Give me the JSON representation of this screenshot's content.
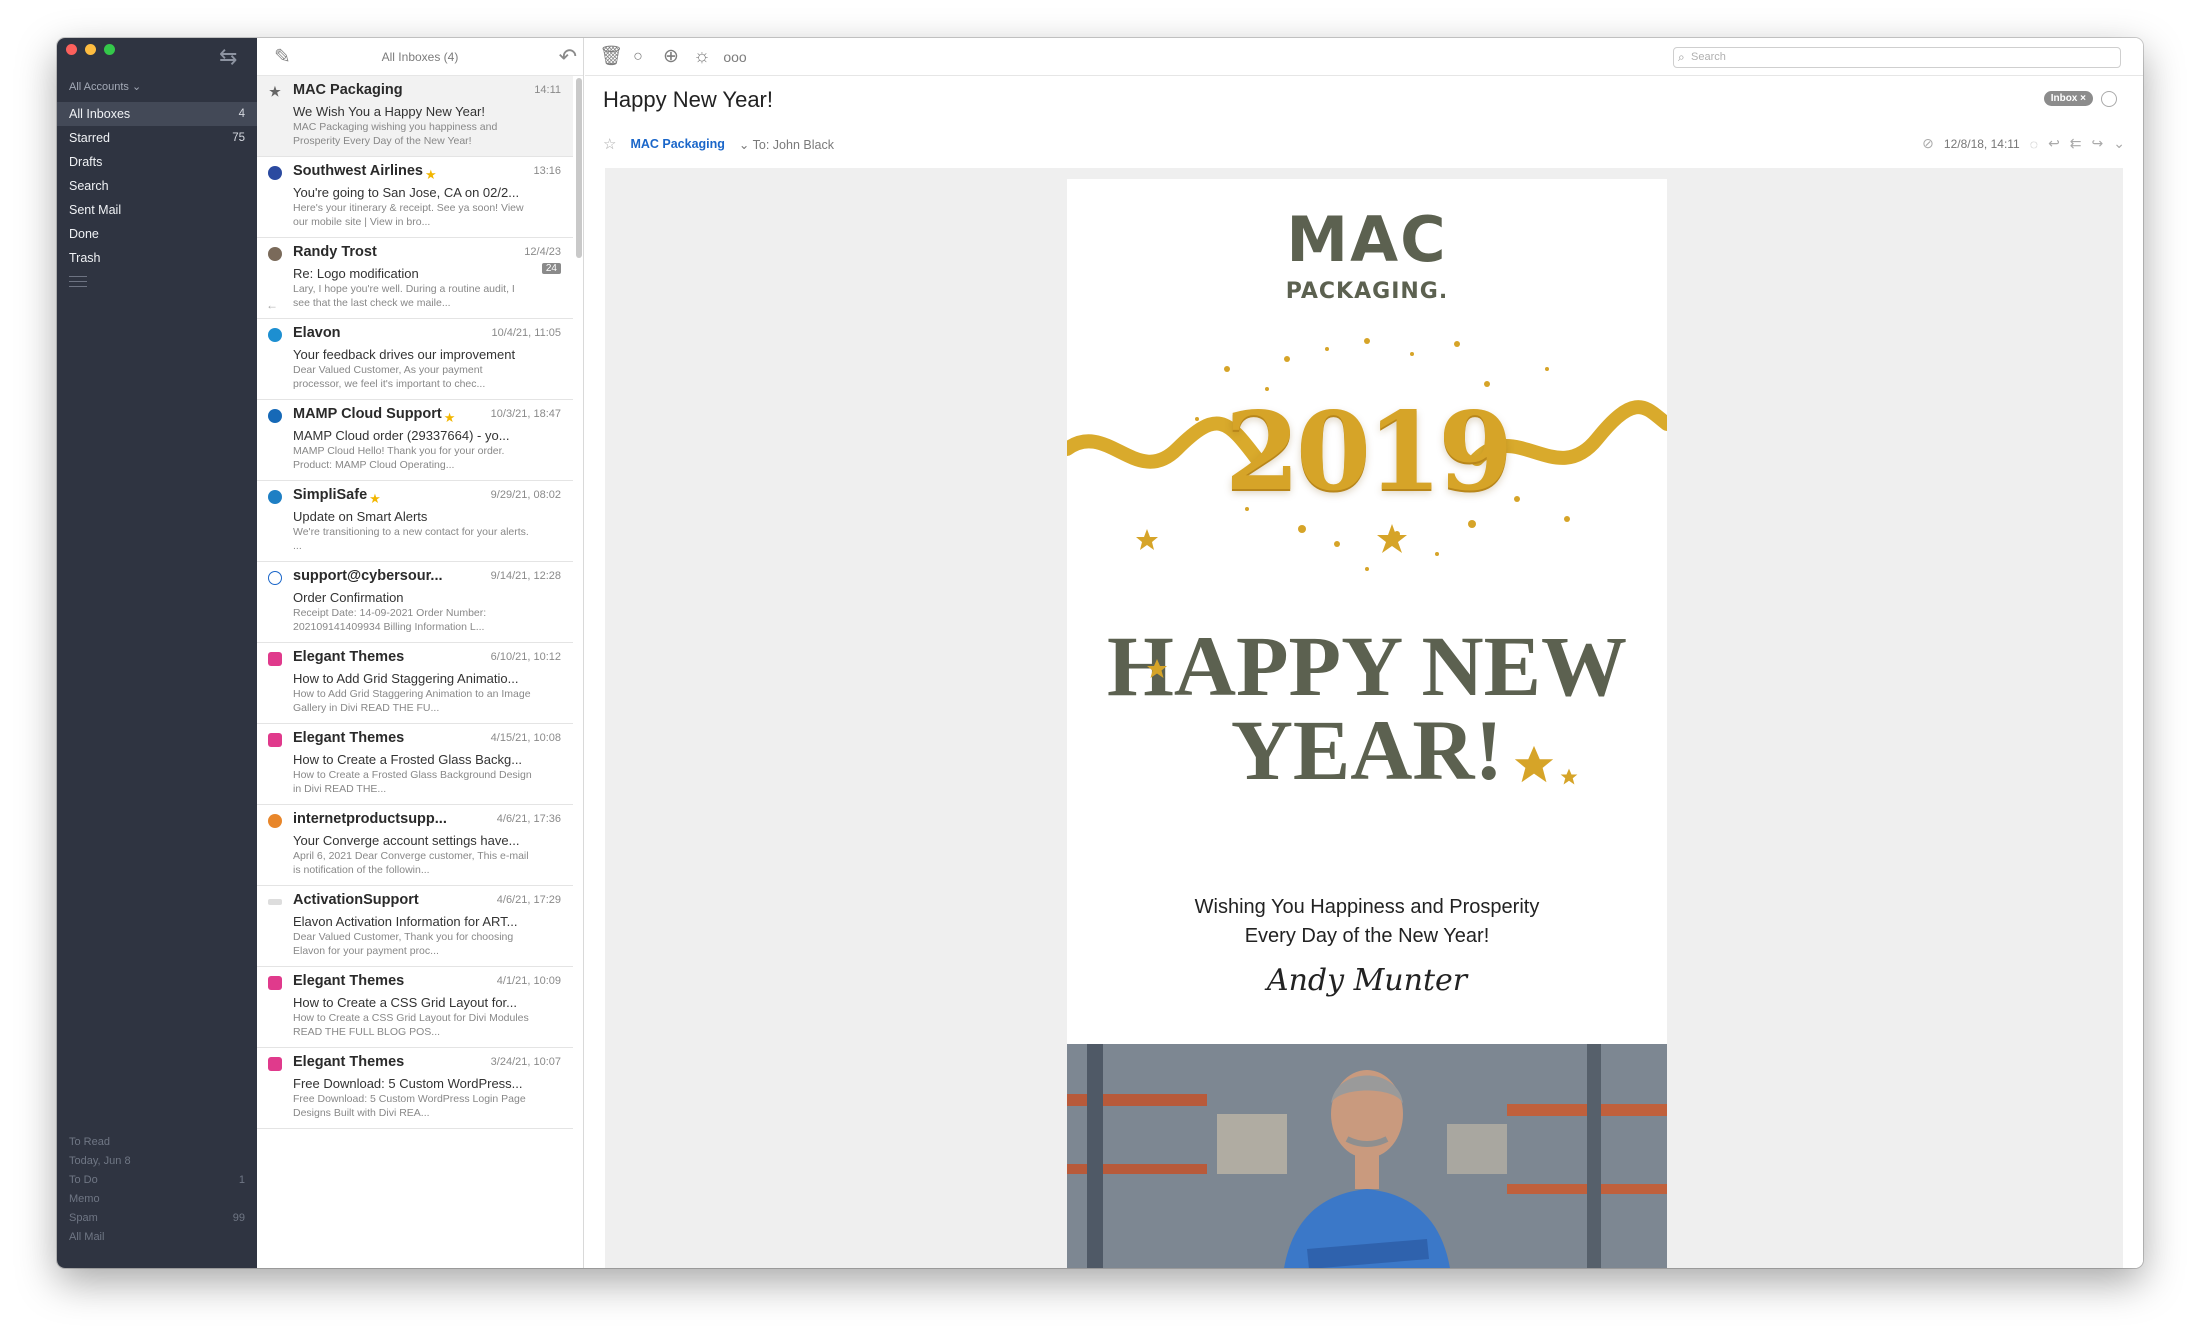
{
  "sidebar": {
    "accounts_label": "All Accounts ⌄",
    "items": [
      {
        "label": "All Inboxes",
        "count": "4"
      },
      {
        "label": "Starred",
        "count": "75"
      },
      {
        "label": "Drafts",
        "count": ""
      },
      {
        "label": "Search",
        "count": ""
      },
      {
        "label": "Sent Mail",
        "count": ""
      },
      {
        "label": "Done",
        "count": ""
      },
      {
        "label": "Trash",
        "count": ""
      }
    ],
    "bottom_items": [
      {
        "label": "To Read",
        "count": ""
      },
      {
        "label": "Today, Jun 8",
        "count": ""
      },
      {
        "label": "To Do",
        "count": "1"
      },
      {
        "label": "Memo",
        "count": ""
      },
      {
        "label": "Spam",
        "count": "99"
      },
      {
        "label": "All Mail",
        "count": ""
      }
    ]
  },
  "list": {
    "title": "All Inboxes (4)",
    "messages": [
      {
        "sender": "MAC Packaging",
        "date": "14:11",
        "subject": "We Wish You a Happy New Year!",
        "preview": "MAC Packaging wishing you happiness and Prosperity Every Day of the New Year!",
        "star": ""
      },
      {
        "sender": "Southwest Airlines",
        "date": "13:16",
        "subject": "You're going to San Jose, CA on 02/2...",
        "preview": "Here's your itinerary & receipt. See ya soon! View our mobile site | View in bro...",
        "star": "★"
      },
      {
        "sender": "Randy Trost",
        "date": "12/4/23",
        "subject": "Re: Logo modification",
        "preview": "Lary, I hope you're well. During a routine audit, I see that the last check we maile...",
        "star": "",
        "badge": "24"
      },
      {
        "sender": "Elavon",
        "date": "10/4/21, 11:05",
        "subject": "Your feedback drives our improvement",
        "preview": "Dear Valued Customer, As your payment processor, we feel it's important to chec...",
        "star": ""
      },
      {
        "sender": "MAMP Cloud Support",
        "date": "10/3/21, 18:47",
        "subject": "MAMP Cloud order (29337664) - yo...",
        "preview": "MAMP Cloud Hello! Thank you for your order. Product: MAMP Cloud Operating...",
        "star": "★"
      },
      {
        "sender": "SimpliSafe",
        "date": "9/29/21, 08:02",
        "subject": "Update on Smart Alerts",
        "preview": "We're transitioning to a new contact for your alerts.          ...",
        "star": "★"
      },
      {
        "sender": "support@cybersour...",
        "date": "9/14/21, 12:28",
        "subject": "Order Confirmation",
        "preview": "Receipt Date: 14-09-2021 Order Number: 202109141409934 Billing Information L...",
        "star": ""
      },
      {
        "sender": "Elegant Themes",
        "date": "6/10/21, 10:12",
        "subject": "How to Add Grid Staggering Animatio...",
        "preview": "How to Add Grid Staggering Animation to an Image Gallery in Divi READ THE FU...",
        "star": ""
      },
      {
        "sender": "Elegant Themes",
        "date": "4/15/21, 10:08",
        "subject": "How to Create a Frosted Glass Backg...",
        "preview": "How to Create a Frosted Glass Background Design in Divi READ THE...",
        "star": ""
      },
      {
        "sender": "internetproductsupp...",
        "date": "4/6/21, 17:36",
        "subject": "Your Converge account settings have...",
        "preview": "April 6, 2021 Dear Converge customer, This e-mail is notification of the followin...",
        "star": ""
      },
      {
        "sender": "ActivationSupport",
        "date": "4/6/21, 17:29",
        "subject": "Elavon Activation Information for ART...",
        "preview": "Dear Valued Customer, Thank you for choosing Elavon for your payment proc...",
        "star": ""
      },
      {
        "sender": "Elegant Themes",
        "date": "4/1/21, 10:09",
        "subject": "How to Create a CSS Grid Layout for...",
        "preview": "How to Create a CSS Grid Layout for Divi Modules READ THE FULL BLOG POS...",
        "star": ""
      },
      {
        "sender": "Elegant Themes",
        "date": "3/24/21, 10:07",
        "subject": "Free Download: 5 Custom WordPress...",
        "preview": "Free Download: 5 Custom WordPress Login Page Designs Built with Divi REA...",
        "star": ""
      }
    ]
  },
  "reader": {
    "search_placeholder": "Search",
    "subject": "Happy New Year!",
    "inbox_tag": "Inbox ×",
    "from": "MAC Packaging",
    "to": "To: John Black",
    "date": "12/8/18, 14:11"
  },
  "email": {
    "logo_line1": "MAC",
    "logo_line2": "PACKAGING.",
    "year": "2019",
    "headline": "HAPPY NEW YEAR!",
    "wish_line1": "Wishing You Happiness and Prosperity",
    "wish_line2": "Every Day of the New Year!",
    "signature": "Andy Munter"
  },
  "colors": {
    "sidebar_bg": "#2f3441",
    "accent_blue": "#1a66c9",
    "olive_text": "#5c6150",
    "gold": "#d6a428"
  }
}
